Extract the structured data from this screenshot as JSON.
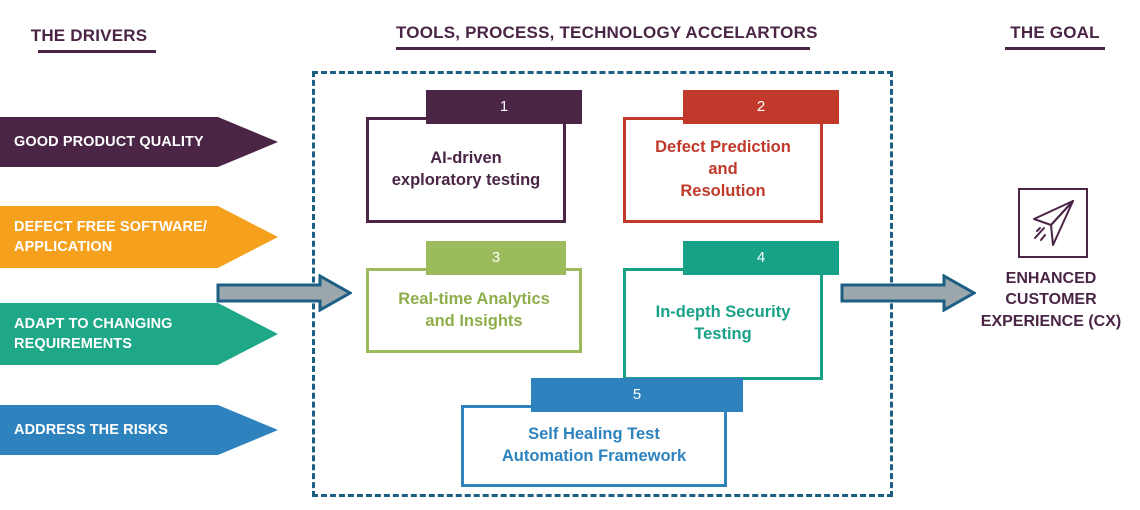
{
  "headings": {
    "drivers": "THE DRIVERS",
    "tools": "TOOLS, PROCESS, TECHNOLOGY ACCELARTORS",
    "goal": "THE GOAL"
  },
  "drivers": [
    {
      "label": "GOOD PRODUCT QUALITY",
      "color": "#4A2545"
    },
    {
      "label": "DEFECT FREE SOFTWARE/ APPLICATION",
      "color": "#F5A11E"
    },
    {
      "label": "ADAPT TO CHANGING REQUIREMENTS",
      "color": "#1FA887"
    },
    {
      "label": "ADDRESS THE RISKS",
      "color": "#2E82BE"
    }
  ],
  "driver_lines": [
    [
      "GOOD PRODUCT QUALITY"
    ],
    [
      "DEFECT FREE SOFTWARE/",
      "APPLICATION"
    ],
    [
      "ADAPT TO CHANGING",
      "REQUIREMENTS"
    ],
    [
      "ADDRESS THE RISKS"
    ]
  ],
  "accelerators": [
    {
      "number": "1",
      "title": "AI-driven exploratory testing",
      "lines": [
        "AI-driven",
        "exploratory testing"
      ],
      "color": "#4A2545"
    },
    {
      "number": "2",
      "title": "Defect Prediction and Resolution",
      "lines": [
        "Defect Prediction",
        "and",
        "Resolution"
      ],
      "color": "#C0392B"
    },
    {
      "number": "3",
      "title": "Real-time Analytics and Insights",
      "lines": [
        "Real-time Analytics",
        "and Insights"
      ],
      "color": "#9CBB5C"
    },
    {
      "number": "4",
      "title": "In-depth Security Testing",
      "lines": [
        "In-depth Security",
        "Testing"
      ],
      "color": "#17A187"
    },
    {
      "number": "5",
      "title": "Self Healing Test Automation Framework",
      "lines": [
        "Self Healing Test",
        "Automation Framework"
      ],
      "color": "#2E82BE"
    }
  ],
  "goal": {
    "icon": "paper-plane-icon",
    "lines": [
      "ENHANCED",
      "CUSTOMER",
      "EXPERIENCE (CX)"
    ],
    "label": "ENHANCED CUSTOMER EXPERIENCE (CX)",
    "color": "#4A2545"
  },
  "connectors": {
    "fill": "#9BA7AD",
    "stroke": "#1D5E84",
    "left_name": "drivers-to-accelerators-arrow",
    "right_name": "accelerators-to-goal-arrow"
  },
  "container": {
    "border_color": "#1D5E84",
    "border_style": "dashed"
  }
}
